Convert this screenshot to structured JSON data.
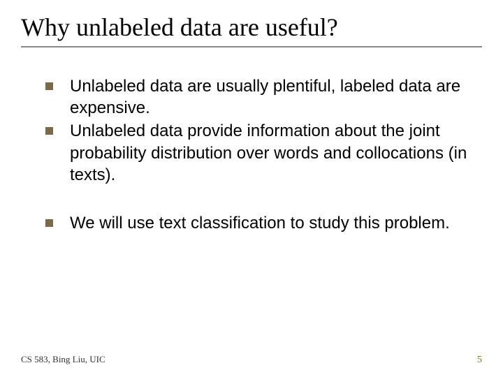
{
  "title": "Why unlabeled data are useful?",
  "bullets_group1": [
    "Unlabeled data are usually plentiful, labeled data are expensive.",
    "Unlabeled data provide information about the joint probability distribution over words and collocations (in texts)."
  ],
  "bullets_group2": [
    "We will use text classification to study this problem."
  ],
  "footer_left": "CS 583, Bing Liu, UIC",
  "page_number": "5"
}
